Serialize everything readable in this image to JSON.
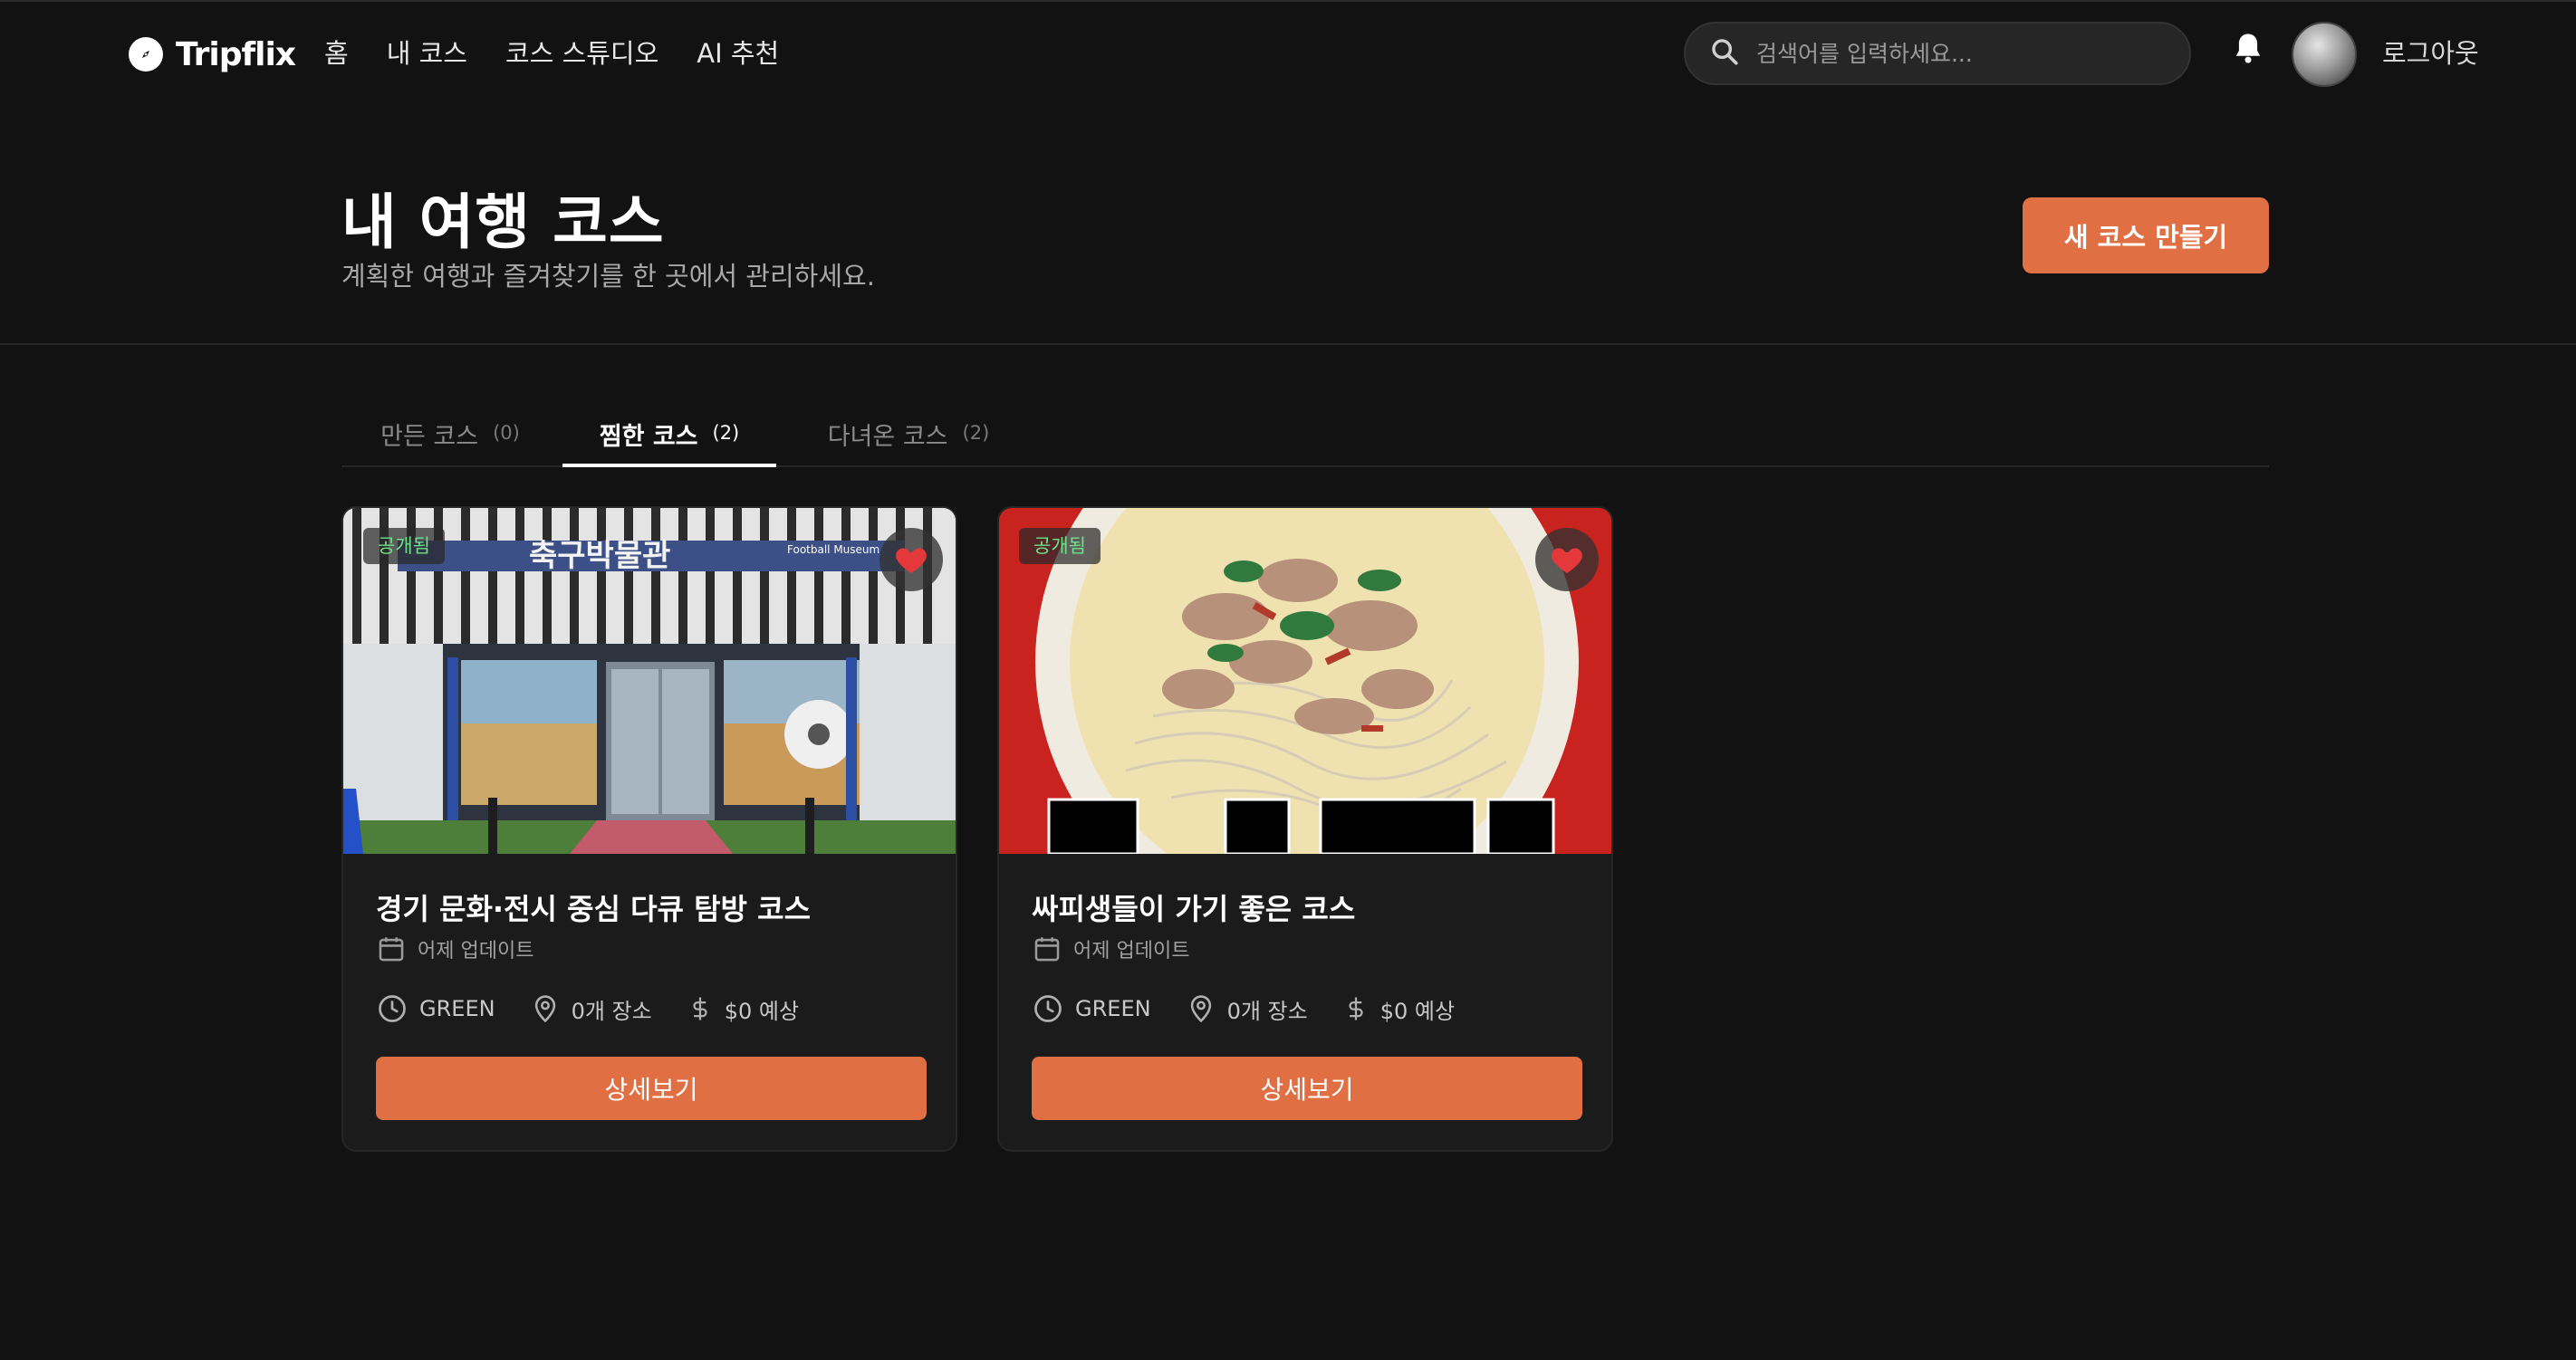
{
  "app": {
    "name": "Tripflix"
  },
  "nav": {
    "links": [
      "홈",
      "내 코스",
      "코스 스튜디오",
      "AI 추천"
    ],
    "search_placeholder": "검색어를 입력하세요...",
    "logout": "로그아웃"
  },
  "header": {
    "title": "내 여행 코스",
    "subtitle": "계획한 여행과 즐겨찾기를 한 곳에서 관리하세요.",
    "new_course_button": "새 코스 만들기"
  },
  "tabs": [
    {
      "label": "만든 코스",
      "count": "(0)",
      "active": false
    },
    {
      "label": "찜한 코스",
      "count": "(2)",
      "active": true
    },
    {
      "label": "다녀온 코스",
      "count": "(2)",
      "active": false
    }
  ],
  "cards": [
    {
      "badge": "공개됨",
      "image_caption": "축구박물관",
      "image_sign_small": "Football Museum",
      "title": "경기 문화·전시 중심 다큐 탐방 코스",
      "updated": "어제 업데이트",
      "type": "GREEN",
      "places": "0개 장소",
      "budget": "$0 예상",
      "button": "상세보기",
      "liked": true
    },
    {
      "badge": "공개됨",
      "title": "싸피생들이 가기 좋은 코스",
      "updated": "어제 업데이트",
      "type": "GREEN",
      "places": "0개 장소",
      "budget": "$0 예상",
      "button": "상세보기",
      "liked": true
    }
  ],
  "colors": {
    "background": "#121212",
    "accent": "#e07044",
    "card": "#1b1b1b",
    "badge_text": "#6ee08a",
    "heart": "#e5383b"
  }
}
